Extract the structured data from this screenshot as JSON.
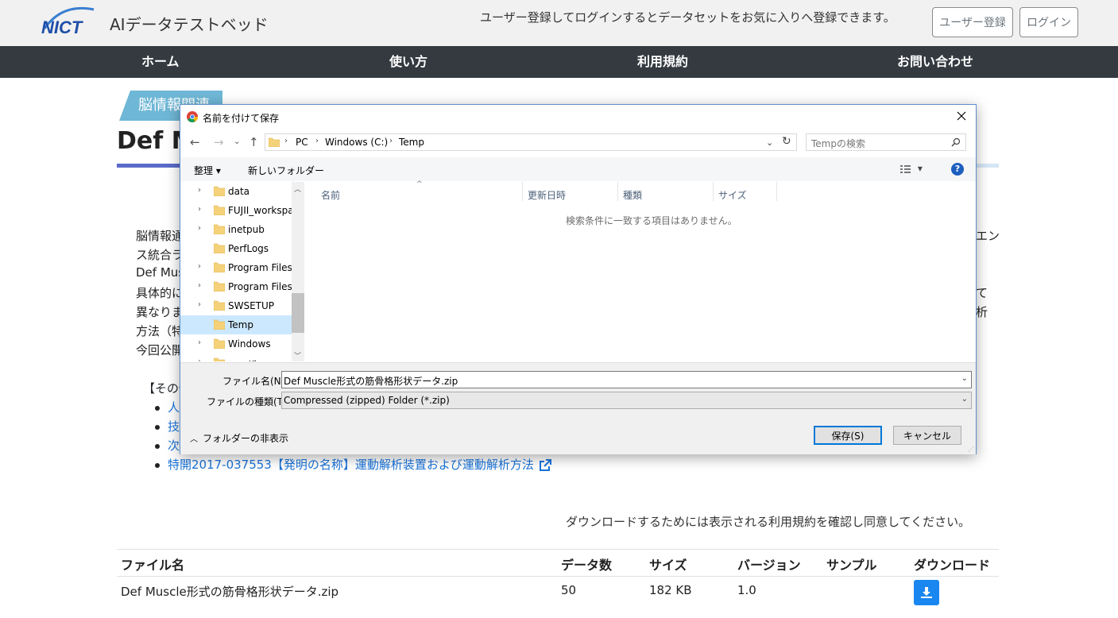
{
  "header": {
    "logo_text": "NICT",
    "site_name": "AIデータテストベッド",
    "message": "ユーザー登録してログインするとデータセットをお気に入りへ登録できます。",
    "register_label": "ユーザー登録",
    "login_label": "ログイン"
  },
  "nav": {
    "items": [
      "ホーム",
      "使い方",
      "利用規約",
      "お問い合わせ"
    ]
  },
  "page": {
    "category": "脳情報関連",
    "title": "Def M",
    "description_left": [
      "脳情報通",
      "ス統合ラ",
      "Def Mus",
      "具体的に",
      "異なりま",
      "方法（特",
      "今回公開"
    ],
    "description_right": [
      "エン",
      "",
      "",
      "て",
      "析"
    ],
    "other_label": "【その他",
    "bullets": [
      "人",
      "技",
      "次",
      "特開2017-037553【発明の名称】運動解析装置および運動解析方法"
    ],
    "agree_note": "ダウンロードするためには表示される利用規約を確認し同意してください。"
  },
  "table": {
    "headers": [
      "ファイル名",
      "データ数",
      "サイズ",
      "バージョン",
      "サンプル",
      "ダウンロード"
    ],
    "rows": [
      {
        "filename": "Def Muscle形式の筋骨格形状データ.zip",
        "count": "50",
        "size": "182 KB",
        "version": "1.0",
        "sample": ""
      }
    ]
  },
  "dialog": {
    "title": "名前を付けて保存",
    "breadcrumb": [
      "PC",
      "Windows (C:)",
      "Temp"
    ],
    "search_placeholder": "Tempの検索",
    "organize_label": "整理 ▾",
    "new_folder_label": "新しいフォルダー",
    "view_label": "▾",
    "help_label": "?",
    "tree": [
      {
        "label": "data",
        "expandable": true,
        "selected": false
      },
      {
        "label": "FUJII_workspac",
        "expandable": true,
        "selected": false
      },
      {
        "label": "inetpub",
        "expandable": true,
        "selected": false
      },
      {
        "label": "PerfLogs",
        "expandable": false,
        "selected": false
      },
      {
        "label": "Program Files",
        "expandable": true,
        "selected": false
      },
      {
        "label": "Program Files (",
        "expandable": true,
        "selected": false
      },
      {
        "label": "SWSETUP",
        "expandable": true,
        "selected": false
      },
      {
        "label": "Temp",
        "expandable": false,
        "selected": true
      },
      {
        "label": "Windows",
        "expandable": true,
        "selected": false
      },
      {
        "label": "ユーザー",
        "expandable": true,
        "selected": false
      }
    ],
    "columns": [
      "名前",
      "更新日時",
      "種類",
      "サイズ"
    ],
    "empty_message": "検索条件に一致する項目はありません。",
    "filename_label": "ファイル名(N):",
    "filename_value": "Def Muscle形式の筋骨格形状データ.zip",
    "filetype_label": "ファイルの種類(T):",
    "filetype_value": "Compressed (zipped) Folder (*.zip)",
    "hide_folders_label": "フォルダーの非表示",
    "save_label": "保存(S)",
    "cancel_label": "キャンセル"
  },
  "colors": {
    "nav_bg": "#343a40",
    "category": "#6fb7d6",
    "accent": "#5b6bc9",
    "link": "#1a73d9",
    "download": "#1a86f0"
  }
}
